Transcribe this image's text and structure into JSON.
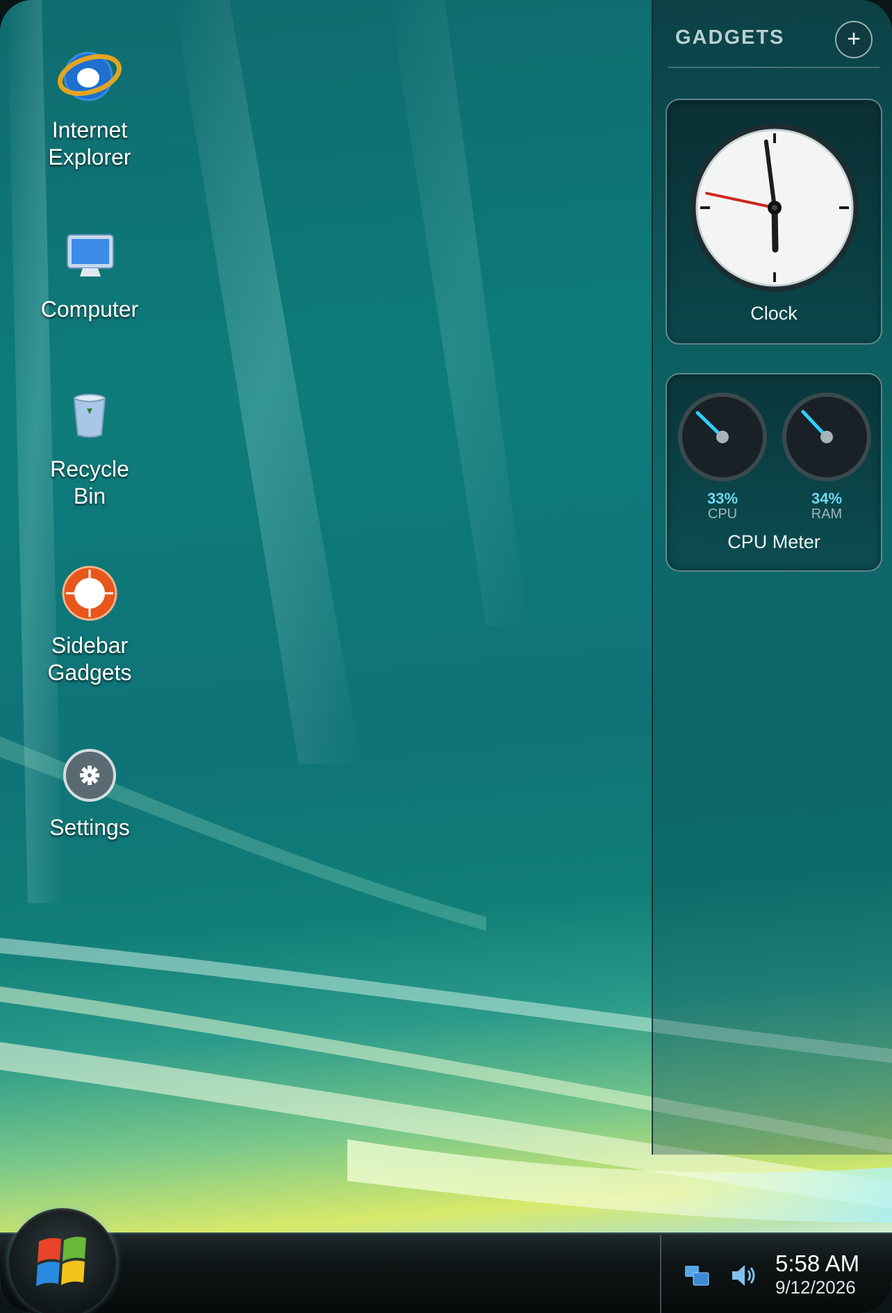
{
  "desktop": {
    "icons": [
      {
        "label": "Internet\nExplorer",
        "icon": "internet-explorer-icon"
      },
      {
        "label": "Computer",
        "icon": "computer-icon"
      },
      {
        "label": "Recycle\nBin",
        "icon": "recycle-bin-icon"
      },
      {
        "label": "Sidebar\nGadgets",
        "icon": "gadgets-icon"
      },
      {
        "label": "Settings",
        "icon": "settings-icon"
      }
    ]
  },
  "sidebar": {
    "title": "GADGETS",
    "add_label": "+",
    "clock": {
      "title": "Clock",
      "hour": 5,
      "minute": 58,
      "second": 47
    },
    "cpu_meter": {
      "title": "CPU Meter",
      "cpu": {
        "name": "CPU",
        "value_text": "33%",
        "percent": 33
      },
      "ram": {
        "name": "RAM",
        "value_text": "34%",
        "percent": 34
      }
    }
  },
  "taskbar": {
    "start_icon": "windows-logo-icon",
    "tray": {
      "network_icon": "network-icon",
      "volume_icon": "volume-icon",
      "time": "5:58 AM",
      "date": "9/12/2026"
    }
  },
  "colors": {
    "accent_gauge": "#2fd0ff",
    "clock_second_hand": "#d0281f",
    "wallpaper_teal": "#0e7c7b",
    "wallpaper_lime": "#d8e96a"
  }
}
